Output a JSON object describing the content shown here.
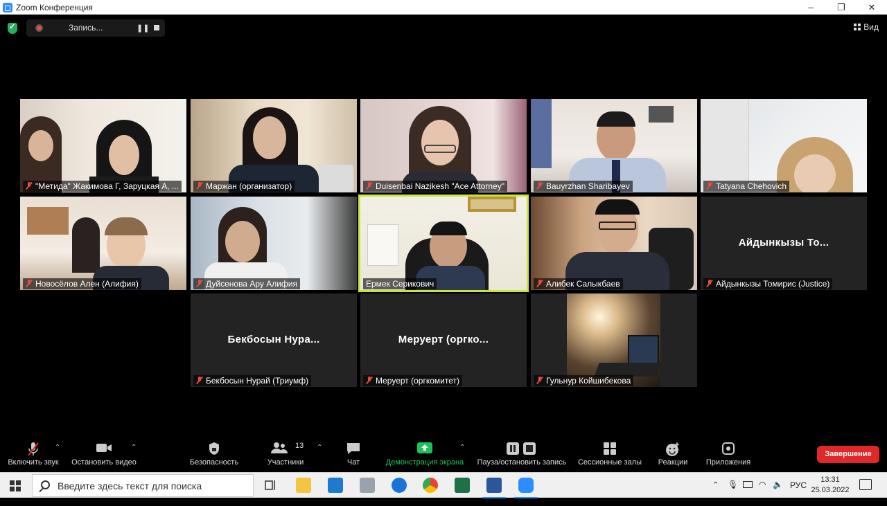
{
  "window": {
    "title": "Zoom Конференция",
    "minimize": "–",
    "maximize": "❐",
    "close": "✕"
  },
  "recording": {
    "label": "Запись..."
  },
  "view": {
    "label": "Вид"
  },
  "participants": [
    {
      "name": "\"Метида\" Жакимова Г, Заруцкая А, ...",
      "muted": true
    },
    {
      "name": "Маржан (организатор)",
      "muted": true
    },
    {
      "name": "Duisenbai Nazikesh \"Ace Attorney\"",
      "muted": true
    },
    {
      "name": "Bauyrzhan Sharibayev",
      "muted": true
    },
    {
      "name": "Tatyana Chehovich",
      "muted": true
    },
    {
      "name": "Новосёлов Ален (Алифия)",
      "muted": true
    },
    {
      "name": "Дуйсенова Ару Алифия",
      "muted": true
    },
    {
      "name": "Ермек Серикович",
      "muted": false,
      "active": true
    },
    {
      "name": "Алибек Салыкбаев",
      "muted": true
    },
    {
      "name": "Айдынкызы Томирис (Justice)",
      "muted": true,
      "display": "Айдынкызы То..."
    },
    {
      "name": "Бекбосын Нурай (Триумф)",
      "muted": true,
      "display": "Бекбосын Нура..."
    },
    {
      "name": "Меруерт (оргкомитет)",
      "muted": true,
      "display": "Меруерт (оргко..."
    },
    {
      "name": "Гульнур Койшибекова",
      "muted": true
    }
  ],
  "toolbar": {
    "unmute": "Включить звук",
    "stop_video": "Остановить видео",
    "security": "Безопасность",
    "participants": "Участники",
    "participants_count": "13",
    "chat": "Чат",
    "share": "Демонстрация экрана",
    "pause_stop_record": "Пауза/остановить запись",
    "breakout": "Сессионные залы",
    "reactions": "Реакции",
    "apps": "Приложения",
    "end": "Завершение"
  },
  "taskbar": {
    "search_placeholder": "Введите здесь текст для поиска",
    "lang": "РУС",
    "time": "13:31",
    "date": "25.03.2022"
  },
  "colors": {
    "accent_green": "#19c35a",
    "end_red": "#e02828",
    "active_border": "#c8e639"
  }
}
